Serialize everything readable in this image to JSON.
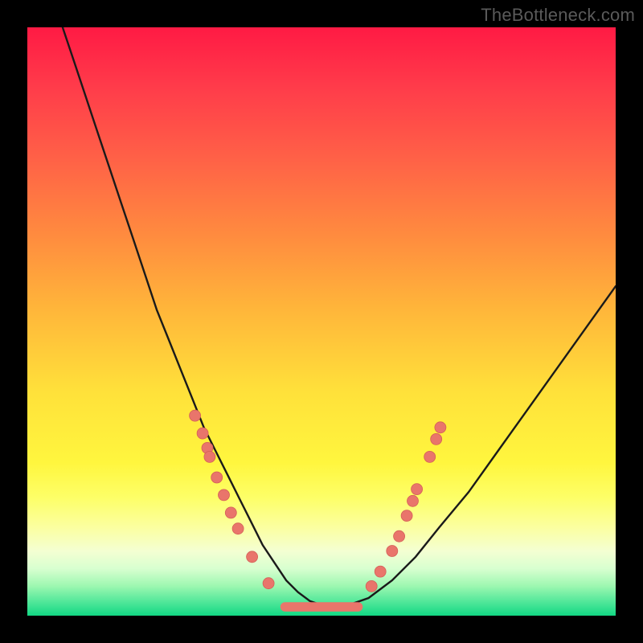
{
  "watermark": "TheBottleneck.com",
  "colors": {
    "curve_stroke": "#1a1a1a",
    "dot_fill": "#e9756b",
    "dot_stroke": "#d45f57"
  },
  "chart_data": {
    "type": "line",
    "title": "",
    "xlabel": "",
    "ylabel": "",
    "xlim": [
      0,
      100
    ],
    "ylim": [
      0,
      100
    ],
    "series": [
      {
        "name": "bottleneck-curve",
        "x": [
          6,
          8,
          10,
          12,
          14,
          16,
          18,
          20,
          22,
          24,
          26,
          28,
          30,
          32,
          34,
          36,
          38,
          40,
          42,
          44,
          46,
          48,
          50,
          52,
          54,
          58,
          62,
          66,
          70,
          75,
          80,
          85,
          90,
          95,
          100
        ],
        "y": [
          100,
          94,
          88,
          82,
          76,
          70,
          64,
          58,
          52,
          47,
          42,
          37,
          32,
          28,
          24,
          20,
          16,
          12,
          9,
          6,
          4,
          2.5,
          1.8,
          1.5,
          1.6,
          3,
          6,
          10,
          15,
          21,
          28,
          35,
          42,
          49,
          56
        ]
      }
    ],
    "dots_left": {
      "name": "left-cluster",
      "points": [
        {
          "x": 28.5,
          "y": 34
        },
        {
          "x": 29.8,
          "y": 31
        },
        {
          "x": 30.6,
          "y": 28.5
        },
        {
          "x": 31.0,
          "y": 27
        },
        {
          "x": 32.2,
          "y": 23.5
        },
        {
          "x": 33.4,
          "y": 20.5
        },
        {
          "x": 34.6,
          "y": 17.5
        },
        {
          "x": 35.8,
          "y": 14.8
        },
        {
          "x": 38.2,
          "y": 10
        },
        {
          "x": 41.0,
          "y": 5.5
        }
      ]
    },
    "dots_right": {
      "name": "right-cluster",
      "points": [
        {
          "x": 58.5,
          "y": 5
        },
        {
          "x": 60.0,
          "y": 7.5
        },
        {
          "x": 62.0,
          "y": 11
        },
        {
          "x": 63.2,
          "y": 13.5
        },
        {
          "x": 64.5,
          "y": 17
        },
        {
          "x": 65.5,
          "y": 19.5
        },
        {
          "x": 66.2,
          "y": 21.5
        },
        {
          "x": 68.4,
          "y": 27
        },
        {
          "x": 69.5,
          "y": 30
        },
        {
          "x": 70.2,
          "y": 32
        }
      ]
    },
    "flat_segment": {
      "name": "bottom-flat",
      "x_start": 43,
      "x_end": 57,
      "y": 1.5,
      "thickness_pct": 1.6
    }
  }
}
